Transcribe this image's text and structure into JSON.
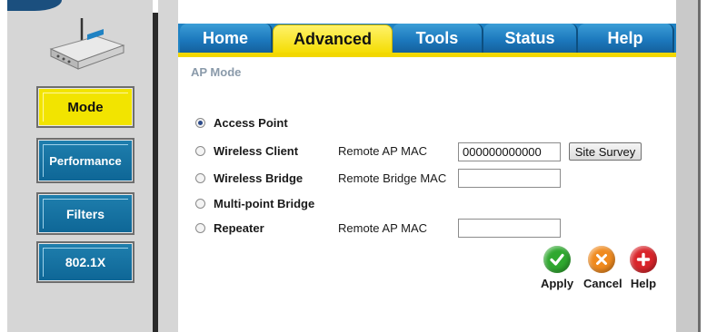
{
  "tabs": [
    {
      "label": "Home"
    },
    {
      "label": "Advanced"
    },
    {
      "label": "Tools"
    },
    {
      "label": "Status"
    },
    {
      "label": "Help"
    }
  ],
  "sidebar": {
    "items": [
      {
        "label": "Mode",
        "active": true
      },
      {
        "label": "Performance"
      },
      {
        "label": "Filters"
      },
      {
        "label": "802.1X"
      }
    ]
  },
  "main": {
    "section_title": "AP Mode",
    "options": [
      {
        "label": "Access Point",
        "checked": true
      },
      {
        "label": "Wireless Client",
        "field_label": "Remote AP MAC",
        "value": "000000000000",
        "button": "Site Survey"
      },
      {
        "label": "Wireless Bridge",
        "field_label": "Remote Bridge MAC",
        "value": ""
      },
      {
        "label": "Multi-point Bridge"
      },
      {
        "label": "Repeater",
        "field_label": "Remote AP MAC",
        "value": ""
      }
    ]
  },
  "actions": {
    "apply": "Apply",
    "cancel": "Cancel",
    "help": "Help"
  },
  "colors": {
    "tab_blue": "#1f82c3",
    "tab_active": "#f4dc00",
    "sidebar_blue": "#0e6696",
    "sidebar_active": "#f2e400",
    "apply_green": "#2fa82f",
    "cancel_orange": "#f08a1e",
    "help_red": "#d9242a"
  },
  "icons": [
    "router-icon",
    "checkmark-icon",
    "x-icon",
    "plus-icon"
  ]
}
